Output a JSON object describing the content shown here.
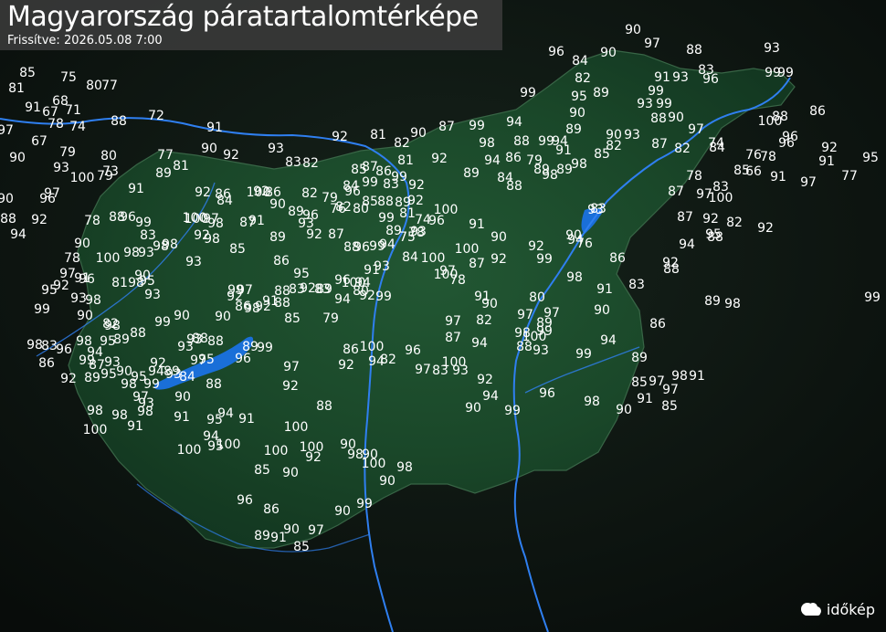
{
  "title": "Magyarország páratartalomtérképe",
  "subtitle": "Frissítve: 2026.05.08 7:00",
  "brand": "időkép",
  "colors": {
    "land": "#1c4a2c",
    "lake": "#1a6fd8",
    "river": "#2f7ff0",
    "text": "#ffffff"
  },
  "values": [
    "90",
    "97",
    "88",
    "96",
    "84",
    "90",
    "93",
    "82",
    "85",
    "75",
    "80",
    "77",
    "81",
    "99",
    "91",
    "93",
    "83",
    "99",
    "99",
    "89",
    "95",
    "93",
    "99",
    "89",
    "99",
    "96",
    "91",
    "67",
    "71",
    "90",
    "88",
    "90",
    "68",
    "74",
    "72",
    "97",
    "100",
    "88",
    "78",
    "67",
    "91",
    "88",
    "86",
    "97",
    "92",
    "81",
    "82",
    "90",
    "87",
    "99",
    "94",
    "98",
    "88",
    "99",
    "94",
    "91",
    "82",
    "90",
    "93",
    "96",
    "87",
    "84",
    "82",
    "74",
    "96",
    "95",
    "92",
    "91",
    "90",
    "79",
    "80",
    "73",
    "77",
    "81",
    "90",
    "93",
    "83",
    "82",
    "92",
    "89",
    "92",
    "89",
    "94",
    "86",
    "79",
    "89",
    "98",
    "89",
    "98",
    "85",
    "76",
    "66",
    "78",
    "77",
    "97",
    "91",
    "85",
    "83",
    "97",
    "78",
    "87",
    "84",
    "88",
    "93",
    "100",
    "79",
    "90",
    "97",
    "91",
    "92",
    "84",
    "100",
    "86",
    "86",
    "82",
    "79",
    "76",
    "84",
    "85",
    "87",
    "99",
    "86",
    "83",
    "99",
    "81",
    "92",
    "88",
    "92",
    "96",
    "94",
    "97",
    "100",
    "98",
    "87",
    "91",
    "92",
    "90",
    "89",
    "96",
    "93",
    "82",
    "96",
    "80",
    "85",
    "88",
    "99",
    "89",
    "92",
    "81",
    "93",
    "74",
    "96",
    "100",
    "91",
    "90",
    "92",
    "90",
    "94",
    "76",
    "83",
    "93",
    "100",
    "87",
    "92",
    "82",
    "92",
    "88",
    "94",
    "95",
    "86",
    "92",
    "100",
    "99",
    "83",
    "78",
    "88",
    "96",
    "98",
    "92",
    "98",
    "93",
    "90",
    "85",
    "89",
    "92",
    "87",
    "88",
    "96",
    "99",
    "94",
    "89",
    "75",
    "78",
    "84",
    "93",
    "91",
    "94",
    "92",
    "100",
    "89",
    "96",
    "95",
    "88",
    "83",
    "86",
    "90",
    "78",
    "91",
    "100",
    "98",
    "93",
    "98",
    "96",
    "98",
    "81",
    "98",
    "95",
    "93",
    "90",
    "88",
    "99",
    "93",
    "90",
    "92",
    "99",
    "86",
    "97",
    "91",
    "98",
    "92",
    "88",
    "85",
    "92",
    "83",
    "79",
    "94",
    "80",
    "99",
    "100",
    "100",
    "97",
    "78",
    "100",
    "87",
    "92",
    "99",
    "98",
    "91",
    "83",
    "88",
    "89",
    "98",
    "90",
    "86",
    "99",
    "97",
    "97",
    "97",
    "82",
    "87",
    "94",
    "91",
    "90",
    "80",
    "99",
    "98",
    "93",
    "100",
    "88",
    "89",
    "99",
    "94",
    "89",
    "85",
    "97",
    "98",
    "91",
    "97",
    "91",
    "85",
    "90",
    "98",
    "96",
    "99",
    "94",
    "90",
    "92",
    "100",
    "93",
    "83",
    "97",
    "96",
    "100",
    "94",
    "82",
    "86",
    "92",
    "97",
    "92",
    "99",
    "87",
    "93",
    "90",
    "94",
    "89",
    "84",
    "97",
    "88",
    "95",
    "93",
    "95",
    "92",
    "93",
    "90",
    "88",
    "96",
    "89",
    "99",
    "94",
    "95",
    "98",
    "89",
    "88",
    "82",
    "99",
    "95",
    "97",
    "92",
    "93",
    "90",
    "96",
    "98",
    "98",
    "83",
    "86",
    "92",
    "89",
    "95",
    "98",
    "97",
    "93",
    "99",
    "98",
    "98",
    "98",
    "100",
    "91",
    "91",
    "95",
    "94",
    "91",
    "94",
    "95",
    "100",
    "100",
    "100",
    "100",
    "100",
    "88",
    "92",
    "90",
    "85",
    "96",
    "86",
    "89",
    "91",
    "90",
    "97",
    "85",
    "90",
    "99",
    "90",
    "98",
    "90",
    "100",
    "90",
    "98"
  ]
}
